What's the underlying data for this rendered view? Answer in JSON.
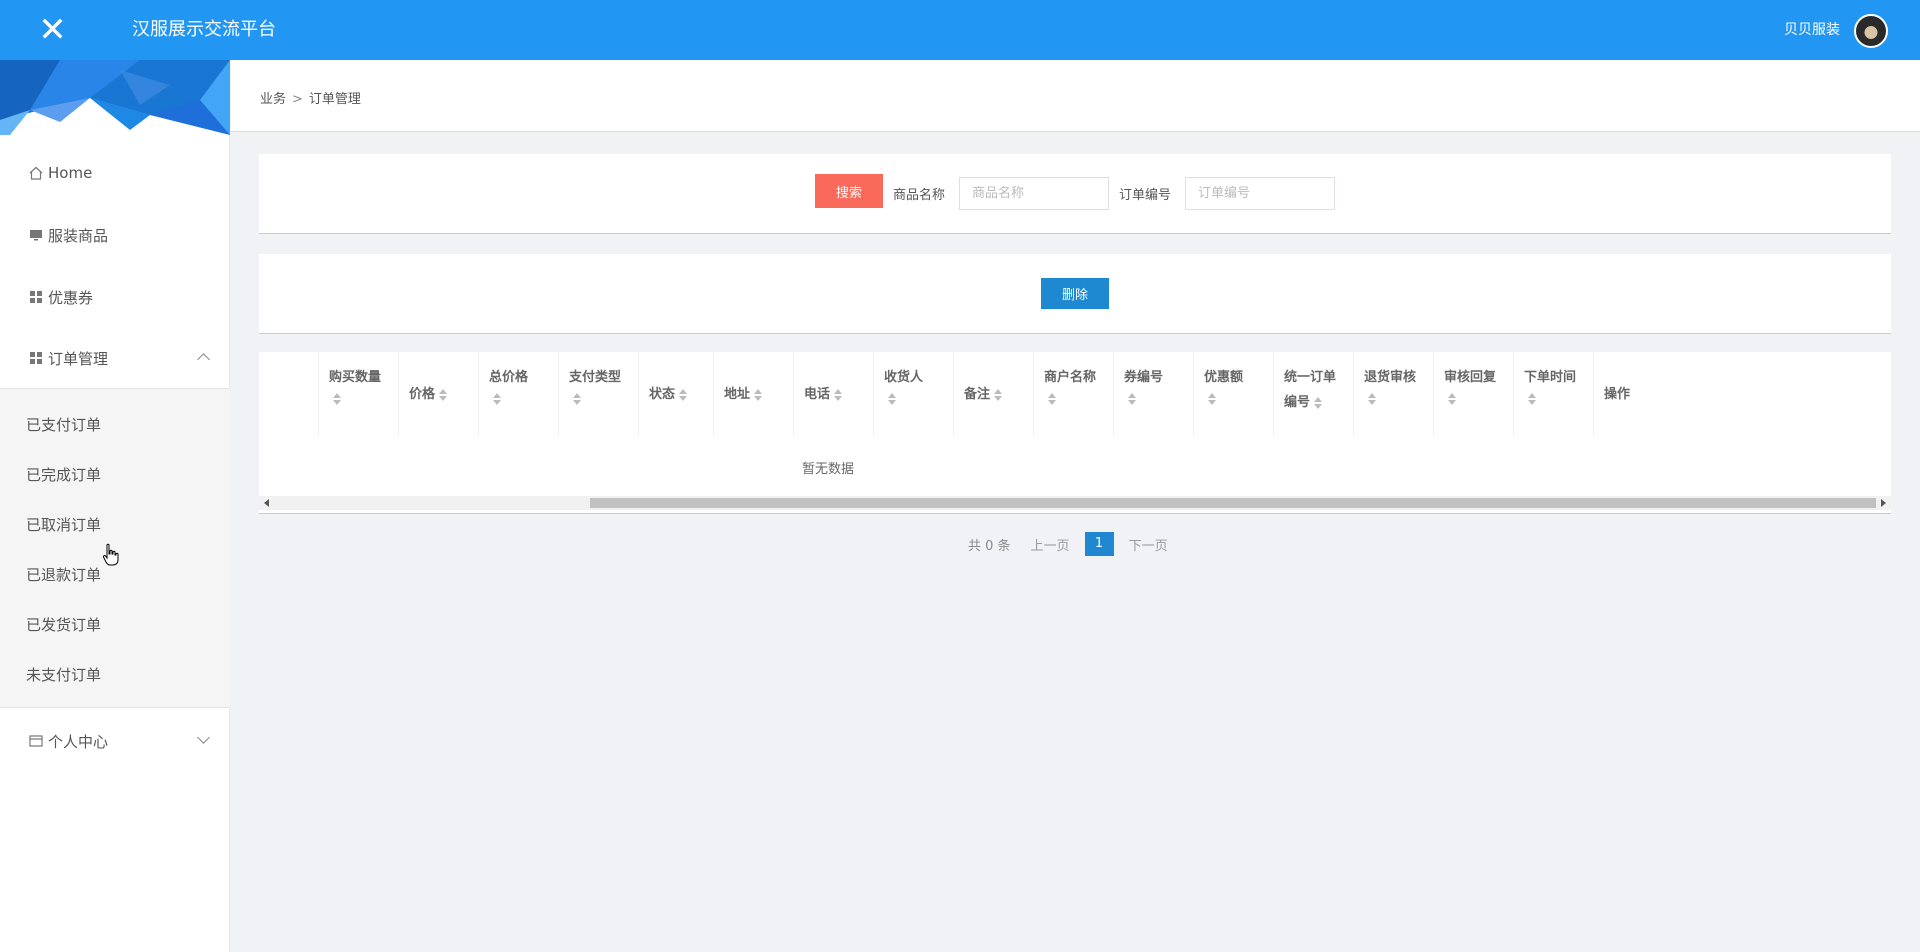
{
  "header": {
    "app_title": "汉服展示交流平台",
    "user_name": "贝贝服装"
  },
  "sidebar": {
    "items": [
      {
        "label": "Home",
        "icon": "home-icon"
      },
      {
        "label": "服装商品",
        "icon": "monitor-icon"
      },
      {
        "label": "优惠券",
        "icon": "grid-icon"
      },
      {
        "label": "订单管理",
        "icon": "grid-icon",
        "expanded": true
      }
    ],
    "order_submenu": [
      "已支付订单",
      "已完成订单",
      "已取消订单",
      "已退款订单",
      "已发货订单",
      "未支付订单"
    ],
    "personal_center": {
      "label": "个人中心",
      "icon": "card-icon",
      "expanded": false
    }
  },
  "breadcrumb": {
    "root": "业务",
    "separator": ">",
    "current": "订单管理"
  },
  "search": {
    "button_label": "搜索",
    "product_label": "商品名称",
    "product_placeholder": "商品名称",
    "order_label": "订单编号",
    "order_placeholder": "订单编号"
  },
  "actions": {
    "delete_label": "删除"
  },
  "table": {
    "columns": [
      "购买数量",
      "价格",
      "总价格",
      "支付类型",
      "状态",
      "地址",
      "电话",
      "收货人",
      "备注",
      "商户名称",
      "券编号",
      "优惠额",
      "统一订单编号",
      "退货审核",
      "审核回复",
      "下单时间",
      "操作"
    ],
    "col_wrap": {
      "统一订单编号": [
        "统一订单",
        "编号"
      ]
    },
    "empty_text": "暂无数据",
    "rows": []
  },
  "pagination": {
    "total_text": "共 0 条",
    "prev": "上一页",
    "current_page": "1",
    "next": "下一页"
  },
  "colors": {
    "header_bg": "#2196f3",
    "search_button": "#f96a5a",
    "primary_button": "#1e88d0"
  }
}
